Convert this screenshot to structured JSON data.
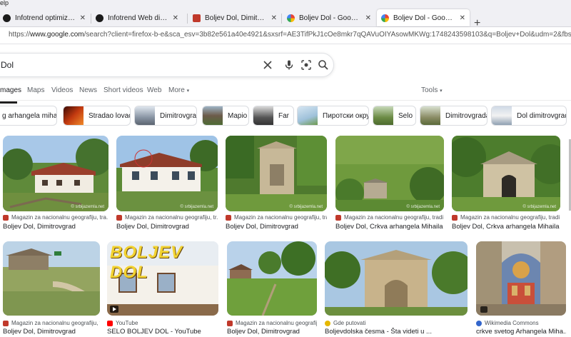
{
  "menu": {
    "help": "elp"
  },
  "tabs": [
    {
      "title": "Infotrend optimizacija Web stra",
      "favicon": "infotrend-icon",
      "active": false
    },
    {
      "title": "Infotrend Web dizajn",
      "favicon": "infotrend-icon",
      "active": false
    },
    {
      "title": "Boljev Dol, Dimitrovgrad",
      "favicon": "magazin-icon",
      "active": false
    },
    {
      "title": "Boljev Dol - Google Search",
      "favicon": "google-icon",
      "active": false
    },
    {
      "title": "Boljev Dol - Google Search",
      "favicon": "google-icon",
      "active": true
    }
  ],
  "url": {
    "scheme": "https://",
    "host": "www.google.com",
    "path": "/search?client=firefox-b-e&sca_esv=3b82e561a40e4921&sxsrf=AE3TifPkJ1cOe8mkr7qQAVuOIYAsowMKWg:1748243598103&q=Boljev+Dol&udm=2&fbs=ABJjpHxU7SXXniUZfeShr2fp4giZ1Y6"
  },
  "search": {
    "query": "Dol"
  },
  "filters": [
    {
      "label": "mages",
      "active": true
    },
    {
      "label": "Maps"
    },
    {
      "label": "Videos"
    },
    {
      "label": "News"
    },
    {
      "label": "Short videos"
    },
    {
      "label": "Web"
    },
    {
      "label": "More"
    },
    {
      "label": "Tools"
    }
  ],
  "chips": [
    {
      "label": "g arhangela mihaila"
    },
    {
      "label": "Stradao lovac"
    },
    {
      "label": "Dimitrovgrad"
    },
    {
      "label": "Mapio"
    },
    {
      "label": "Far"
    },
    {
      "label": "Пиротски округ"
    },
    {
      "label": "Selo"
    },
    {
      "label": "Dimitrovgrada"
    },
    {
      "label": "Dol dimitrovgrad"
    }
  ],
  "results": [
    {
      "source": "Magazin za nacionalnu geografiju, tra...",
      "title": "Boljev Dol, Dimitrovgrad",
      "watermark": "© srbijazemla.net"
    },
    {
      "source": "Magazin za nacionalnu geografiju, tr...",
      "title": "Boljev Dol, Dimitrovgrad",
      "watermark": "© srbijazemla.net"
    },
    {
      "source": "Magazin za nacionalnu geografiju, tra...",
      "title": "Boljev Dol, Dimitrovgrad",
      "watermark": "© srbijazemla.net"
    },
    {
      "source": "Magazin za nacionalnu geografiju, tradi...",
      "title": "Boljev Dol, Crkva arhangela Mihaila",
      "watermark": "© srbijazemla.net"
    },
    {
      "source": "Magazin za nacionalnu geografiju, tradi...",
      "title": "Boljev Dol, Crkva arhangela Mihaila",
      "watermark": "© srbijazemla.net"
    },
    {
      "source": "Magazin za nacionalnu geografiju, tr...",
      "title": "Boljev Dol, Dimitrovgrad",
      "watermark": ""
    },
    {
      "source": "YouTube",
      "title": "SELO BOLJEV DOL - YouTube",
      "overlay": "BOLJEV DOL"
    },
    {
      "source": "Magazin za nacionalnu geografiju, tr...",
      "title": "Boljev Dol, Dimitrovgrad",
      "watermark": ""
    },
    {
      "source": "Gde putovati",
      "title": "Boljevdolska česma - Šta videti u ..."
    },
    {
      "source": "Wikimedia Commons",
      "title": "crkve svetog Arhangela Miha..."
    }
  ]
}
